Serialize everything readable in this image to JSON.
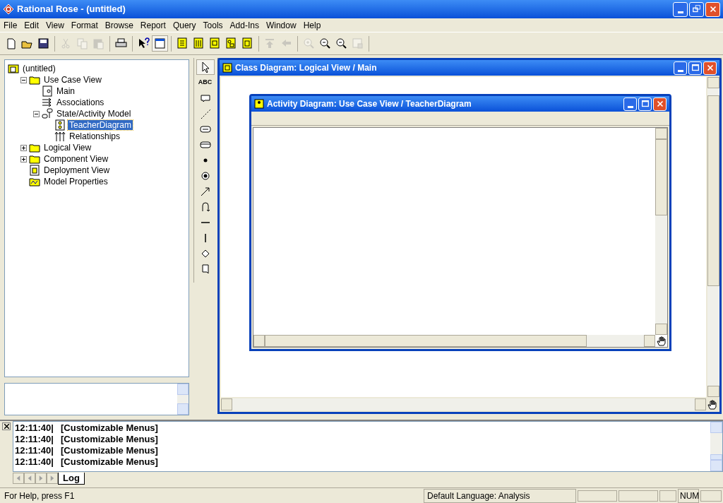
{
  "window": {
    "title": "Rational Rose - (untitled)"
  },
  "menu": [
    "File",
    "Edit",
    "View",
    "Format",
    "Browse",
    "Report",
    "Query",
    "Tools",
    "Add-Ins",
    "Window",
    "Help"
  ],
  "toolbar": [
    {
      "disabled": false,
      "pressed": false
    },
    {
      "disabled": false,
      "pressed": false
    },
    {
      "disabled": false,
      "pressed": false
    },
    {
      "disabled": true,
      "pressed": false
    },
    {
      "disabled": true,
      "pressed": false
    },
    {
      "disabled": true,
      "pressed": false
    },
    {
      "disabled": false,
      "pressed": false
    },
    {
      "disabled": false,
      "pressed": false
    },
    {
      "disabled": false,
      "pressed": true
    },
    {
      "disabled": false,
      "pressed": false
    },
    {
      "disabled": false,
      "pressed": false
    },
    {
      "disabled": false,
      "pressed": false
    },
    {
      "disabled": false,
      "pressed": false
    },
    {
      "disabled": false,
      "pressed": false
    },
    {
      "disabled": true,
      "pressed": false
    },
    {
      "disabled": true,
      "pressed": false
    },
    {
      "disabled": true,
      "pressed": false
    },
    {
      "disabled": false,
      "pressed": false
    },
    {
      "disabled": false,
      "pressed": false
    },
    {
      "disabled": true,
      "pressed": false
    }
  ],
  "tree": [
    {
      "label": "(untitled)",
      "kind": "model",
      "selected": false,
      "children": [
        {
          "label": "Use Case View",
          "kind": "folder",
          "expanded": true,
          "selected": false,
          "children": [
            {
              "label": "Main",
              "kind": "diagram",
              "selected": false
            },
            {
              "label": "Associations",
              "kind": "associations",
              "selected": false
            },
            {
              "label": "State/Activity Model",
              "kind": "statemodel",
              "expanded": true,
              "selected": false,
              "children": [
                {
                  "label": "TeacherDiagram",
                  "kind": "activity",
                  "selected": true
                },
                {
                  "label": "Relationships",
                  "kind": "relationships",
                  "selected": false
                }
              ]
            }
          ]
        },
        {
          "label": "Logical View",
          "kind": "folder",
          "expanded": false,
          "selected": false
        },
        {
          "label": "Component View",
          "kind": "folder",
          "expanded": false,
          "selected": false
        },
        {
          "label": "Deployment View",
          "kind": "deployment",
          "selected": false
        },
        {
          "label": "Model Properties",
          "kind": "properties",
          "selected": false
        }
      ]
    }
  ],
  "palette": [
    {
      "selected": true
    },
    {
      "label": "ABC",
      "selected": false
    },
    {
      "selected": false
    },
    {
      "selected": false
    },
    {
      "selected": false
    },
    {
      "selected": false
    },
    {
      "selected": false
    },
    {
      "selected": false
    },
    {
      "selected": false
    },
    {
      "selected": false
    },
    {
      "selected": false
    },
    {
      "selected": false
    },
    {
      "selected": false
    },
    {
      "selected": false
    }
  ],
  "outer_window": {
    "title": "Class Diagram: Logical View / Main"
  },
  "inner_window": {
    "title": "Activity Diagram: Use Case View / TeacherDiagram"
  },
  "log": {
    "lines": [
      {
        "time": "12:11:40|",
        "text": "[Customizable Menus]"
      },
      {
        "time": "12:11:40|",
        "text": "[Customizable Menus]"
      },
      {
        "time": "12:11:40|",
        "text": "[Customizable Menus]"
      },
      {
        "time": "12:11:40|",
        "text": "[Customizable Menus]"
      }
    ],
    "tabs": [
      {
        "label": "Log",
        "selected": true
      }
    ]
  },
  "status_bar": {
    "help": "For Help, press F1",
    "language": "Default Language: Analysis",
    "num": "NUM"
  }
}
